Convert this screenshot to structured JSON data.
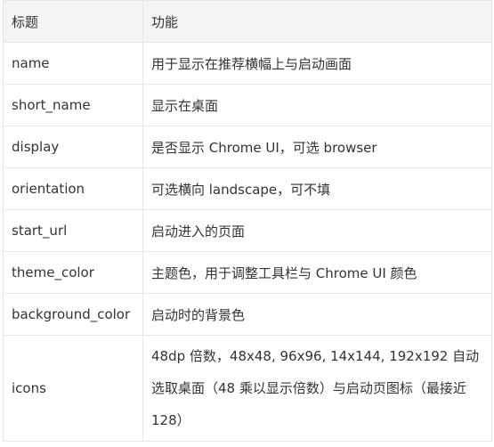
{
  "table": {
    "headers": [
      "标题",
      "功能"
    ],
    "rows": [
      {
        "name": "name",
        "desc": "用于显示在推荐横幅上与启动画面"
      },
      {
        "name": "short_name",
        "desc": "显示在桌面"
      },
      {
        "name": "display",
        "desc": "是否显示 Chrome UI，可选 browser"
      },
      {
        "name": "orientation",
        "desc": "可选横向 landscape，可不填"
      },
      {
        "name": "start_url",
        "desc": "启动进入的页面"
      },
      {
        "name": "theme_color",
        "desc": "主题色，用于调整工具栏与 Chrome UI 颜色"
      },
      {
        "name": "background_color",
        "desc": "启动时的背景色"
      },
      {
        "name": "icons",
        "desc": "48dp 倍数，48x48, 96x96, 14x144, 192x192 自动选取桌面（48 乘以显示倍数）与启动页图标（最接近 128）"
      }
    ]
  }
}
